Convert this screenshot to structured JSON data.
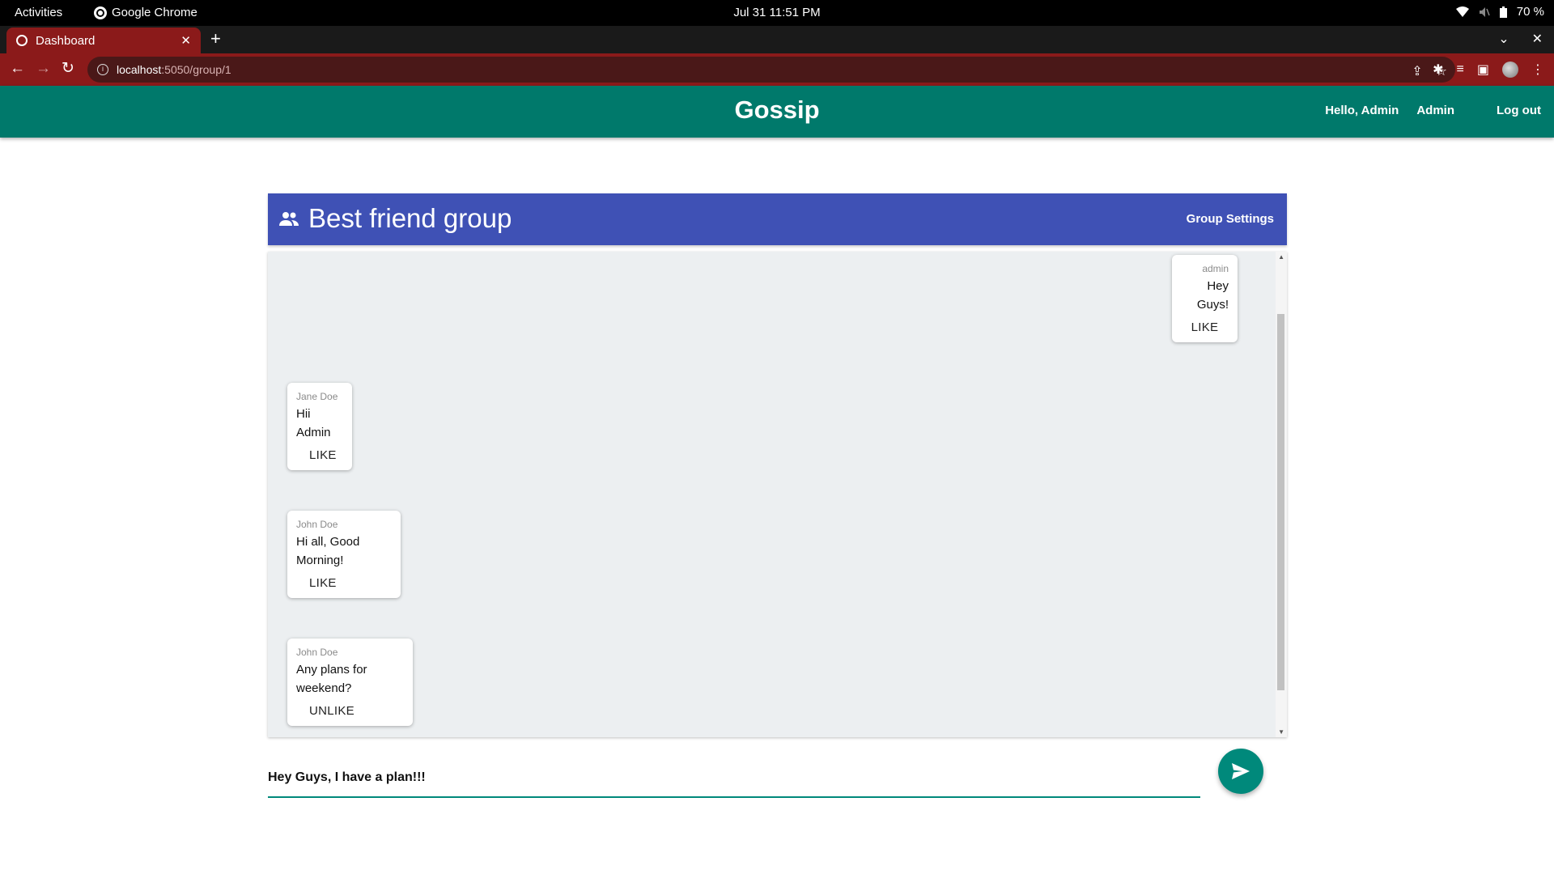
{
  "os": {
    "activities": "Activities",
    "app_name": "Google Chrome",
    "clock": "Jul 31  11:51 PM",
    "battery": "70 %"
  },
  "browser": {
    "tab_title": "Dashboard",
    "url_host": "localhost",
    "url_path": ":5050/group/1"
  },
  "header": {
    "title": "Gossip",
    "greeting": "Hello, Admin",
    "admin_link": "Admin",
    "logout": "Log out"
  },
  "group": {
    "name": "Best friend group",
    "settings_label": "Group Settings"
  },
  "messages": [
    {
      "author": "admin",
      "text_lines": [
        "Hey",
        "Guys!"
      ],
      "action": "LIKE",
      "own": true
    },
    {
      "author": "Jane Doe",
      "text_lines": [
        "Hii",
        "Admin"
      ],
      "action": "LIKE",
      "own": false
    },
    {
      "author": "John Doe",
      "text_lines": [
        "Hi all, Good",
        "Morning!"
      ],
      "action": "LIKE",
      "own": false
    },
    {
      "author": "John Doe",
      "text_lines": [
        "Any plans for",
        "weekend?"
      ],
      "action": "UNLIKE",
      "own": false
    }
  ],
  "composer": {
    "value": "Hey Guys, I have a plan!!!"
  },
  "colors": {
    "app_bar": "#00796b",
    "group_bar": "#3f51b5",
    "accent": "#00897b",
    "chat_bg": "#eceff1"
  }
}
